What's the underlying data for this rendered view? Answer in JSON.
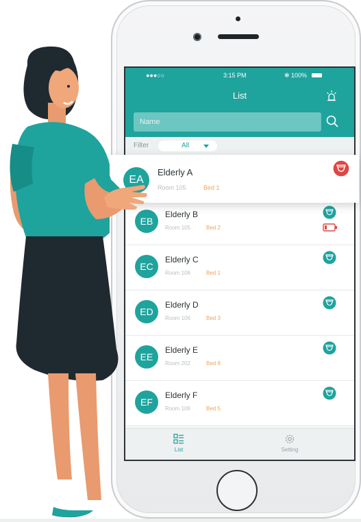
{
  "status_bar": {
    "signal": "●●●○○ ",
    "time": "3:15 PM",
    "battery": "✻ 100%"
  },
  "header": {
    "title": "List",
    "alarm_icon": "alarm-light-icon"
  },
  "search": {
    "placeholder": "Name",
    "icon": "search-icon"
  },
  "filter": {
    "label": "Filter",
    "value": "All"
  },
  "highlight": {
    "initials": "EA",
    "name": "Elderly A",
    "room": "Room 105",
    "bed": "Bed 1",
    "status": "diaper-wet"
  },
  "rows": [
    {
      "initials": "EB",
      "name": "Elderly B",
      "room": "Room 105",
      "bed": "Bed 2",
      "low_battery": true
    },
    {
      "initials": "EC",
      "name": "Elderly C",
      "room": "Room 106",
      "bed": "Bed 1"
    },
    {
      "initials": "ED",
      "name": "Elderly D",
      "room": "Room 106",
      "bed": "Bed 3"
    },
    {
      "initials": "EE",
      "name": "Elderly E",
      "room": "Room 202",
      "bed": "Bed 8"
    },
    {
      "initials": "EF",
      "name": "Elderly F",
      "room": "Room 106",
      "bed": "Bed 5"
    }
  ],
  "tabs": {
    "list": "List",
    "setting": "Setting"
  },
  "colors": {
    "accent": "#1fa39d",
    "alert": "#e04545",
    "bed": "#f0a35b"
  }
}
